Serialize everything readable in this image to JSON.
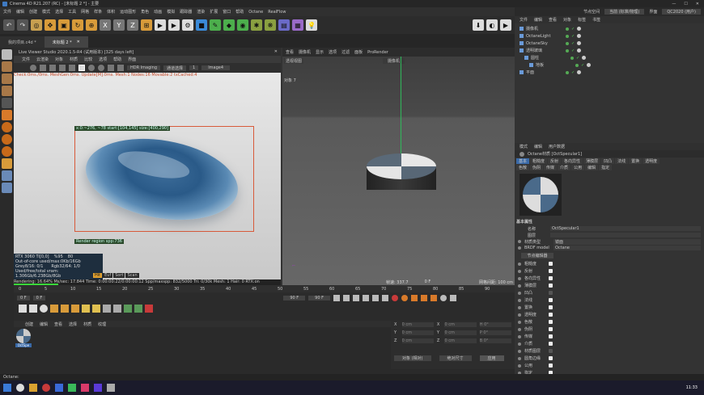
{
  "titlebar": {
    "title": "Cinema 4D R21.207 (RC) - [未标题 2 *] - 主要"
  },
  "menubar": {
    "items": [
      "文件",
      "编辑",
      "创建",
      "模式",
      "选择",
      "工具",
      "网格",
      "样条",
      "体积",
      "运动图形",
      "角色",
      "动画",
      "模拟",
      "跟踪器",
      "渲染",
      "扩展",
      "窗口",
      "帮助",
      "Octane",
      "RealFlow"
    ]
  },
  "layout_label": "界面",
  "layout_value": "QC2020 (用户)",
  "node_space_label": "节点空间",
  "node_space_value": "当前 (标准/物理)",
  "tabs": [
    {
      "label": "我的项目.c4d *"
    },
    {
      "label": "未标题 2 *"
    }
  ],
  "live_viewer": {
    "title": "Live Viewer Studio 2020.1.5-R4 (试用版本) [325 days left]",
    "menu": [
      "文件",
      "云渲染",
      "对象",
      "材质",
      "比较",
      "选项",
      "帮助",
      "界面"
    ],
    "hdr_mode": "HDR Imaging",
    "render_channel": "通道选择",
    "image_label": "Image4",
    "stats": "Check:0ms./0ms. MeshGen:0ms. Update[M]:0ms. Mesh:1 Nodes:16 Movable:2 txCached:4",
    "region_info": "x:0:~276, ~78  start:[104,145] size:[400,290]",
    "render_region": "Render region spp:736",
    "gpu_name": "RTX 3060 Ti[0,0]",
    "gpu_temp": "%95",
    "gpu_num": "80",
    "oo_core": "Out-of-core used/max:0Kb/16Gb",
    "grey": "Grey8/16: 0/1",
    "rgb": "Rgb32/64: 1/0",
    "vram": "Used/free/total vram: 1.306Gb/6.238Gb/8Gb",
    "buttons": [
      "Hit",
      "Euf",
      "Sort",
      "Scan"
    ],
    "rendering": "Rendering: 16.64% Ms/sec: 17.844  Time: 0:00:00:22/0:00:00:12  Spp/maxspp: 832/5000  Tri: 0/30k  Mesh: 1  Hair: 0  RTX:on"
  },
  "viewport": {
    "menu": [
      "查看",
      "摄像机",
      "显示",
      "选项",
      "过滤",
      "面板",
      "ProRender"
    ],
    "view_label": "透视视图",
    "camera_label": "摄像机",
    "obj_count": "对象 7",
    "speed_label": "帧速: 337.7",
    "frame_label": "0 F",
    "grid_label": "网格间距: 100 cm"
  },
  "timeline": {
    "ticks": [
      "0",
      "5",
      "10",
      "15",
      "20",
      "25",
      "30",
      "35",
      "40",
      "45",
      "50",
      "55",
      "60",
      "65",
      "70",
      "75",
      "80",
      "85",
      "90"
    ],
    "start": "0 F",
    "current": "0 F",
    "end": "90 F",
    "max": "90 F",
    "frame_end": "0 F"
  },
  "material_bar": {
    "menu": [
      "创建",
      "编辑",
      "查看",
      "选择",
      "材质",
      "纹理"
    ],
    "material_name": "OctSpe"
  },
  "coords": {
    "labels": [
      "X",
      "Y",
      "Z"
    ],
    "pos": [
      "0 cm",
      "0 cm",
      "0 cm"
    ],
    "size": [
      "0 cm",
      "0 cm",
      "0 cm"
    ],
    "rot": [
      "H 0°",
      "P 0°",
      "B 0°"
    ],
    "mode": "对象 (相对)",
    "size_mode": "绝对尺寸",
    "apply": "应用"
  },
  "object_manager": {
    "menu": [
      "文件",
      "编辑",
      "查看",
      "对象",
      "标签",
      "书签"
    ],
    "objects": [
      {
        "name": "摄像机",
        "indent": 0
      },
      {
        "name": "OctaneLight",
        "indent": 0
      },
      {
        "name": "OctaneSky",
        "indent": 0
      },
      {
        "name": "透明玻璃",
        "indent": 0
      },
      {
        "name": "圆柱",
        "indent": 1
      },
      {
        "name": "地板",
        "indent": 2
      },
      {
        "name": "平面",
        "indent": 0
      }
    ]
  },
  "attributes": {
    "menu": [
      "模式",
      "编辑",
      "用户数据"
    ],
    "material_title": "Octane材质 [OctSpecular1]",
    "tabs_row1": [
      "基本",
      "粗糙度",
      "反射",
      "各向异性",
      "薄膜层",
      "凹凸",
      "法线",
      "置换",
      "透明度"
    ],
    "tabs_row2": [
      "色散",
      "伪阴",
      "传媒",
      "介质",
      "公用",
      "编辑",
      "指定"
    ],
    "section": "基本属性",
    "name_label": "名称",
    "name_value": "OctSpecular1",
    "layer_label": "图层",
    "type_label": "材质类型",
    "type_value": "镜面",
    "brdf_label": "BRDF model",
    "brdf_value": "Octane",
    "node_editor": "节点编辑器",
    "channels": [
      {
        "label": "粗糙度",
        "checked": true
      },
      {
        "label": "反射",
        "checked": true
      },
      {
        "label": "各向异性",
        "checked": true
      },
      {
        "label": "薄膜层",
        "checked": true
      },
      {
        "label": "凹凸",
        "checked": false
      },
      {
        "label": "法线",
        "checked": true
      },
      {
        "label": "置换",
        "checked": true
      },
      {
        "label": "透明度",
        "checked": true
      },
      {
        "label": "色散",
        "checked": true
      },
      {
        "label": "伪阴",
        "checked": true
      },
      {
        "label": "传媒",
        "checked": true
      },
      {
        "label": "介质",
        "checked": true
      },
      {
        "label": "材质图层",
        "checked": false
      },
      {
        "label": "圆角边缘",
        "checked": true
      },
      {
        "label": "公用",
        "checked": true
      },
      {
        "label": "指定",
        "checked": true
      }
    ]
  },
  "status": {
    "text": "Octane:"
  },
  "clock": "11:33"
}
